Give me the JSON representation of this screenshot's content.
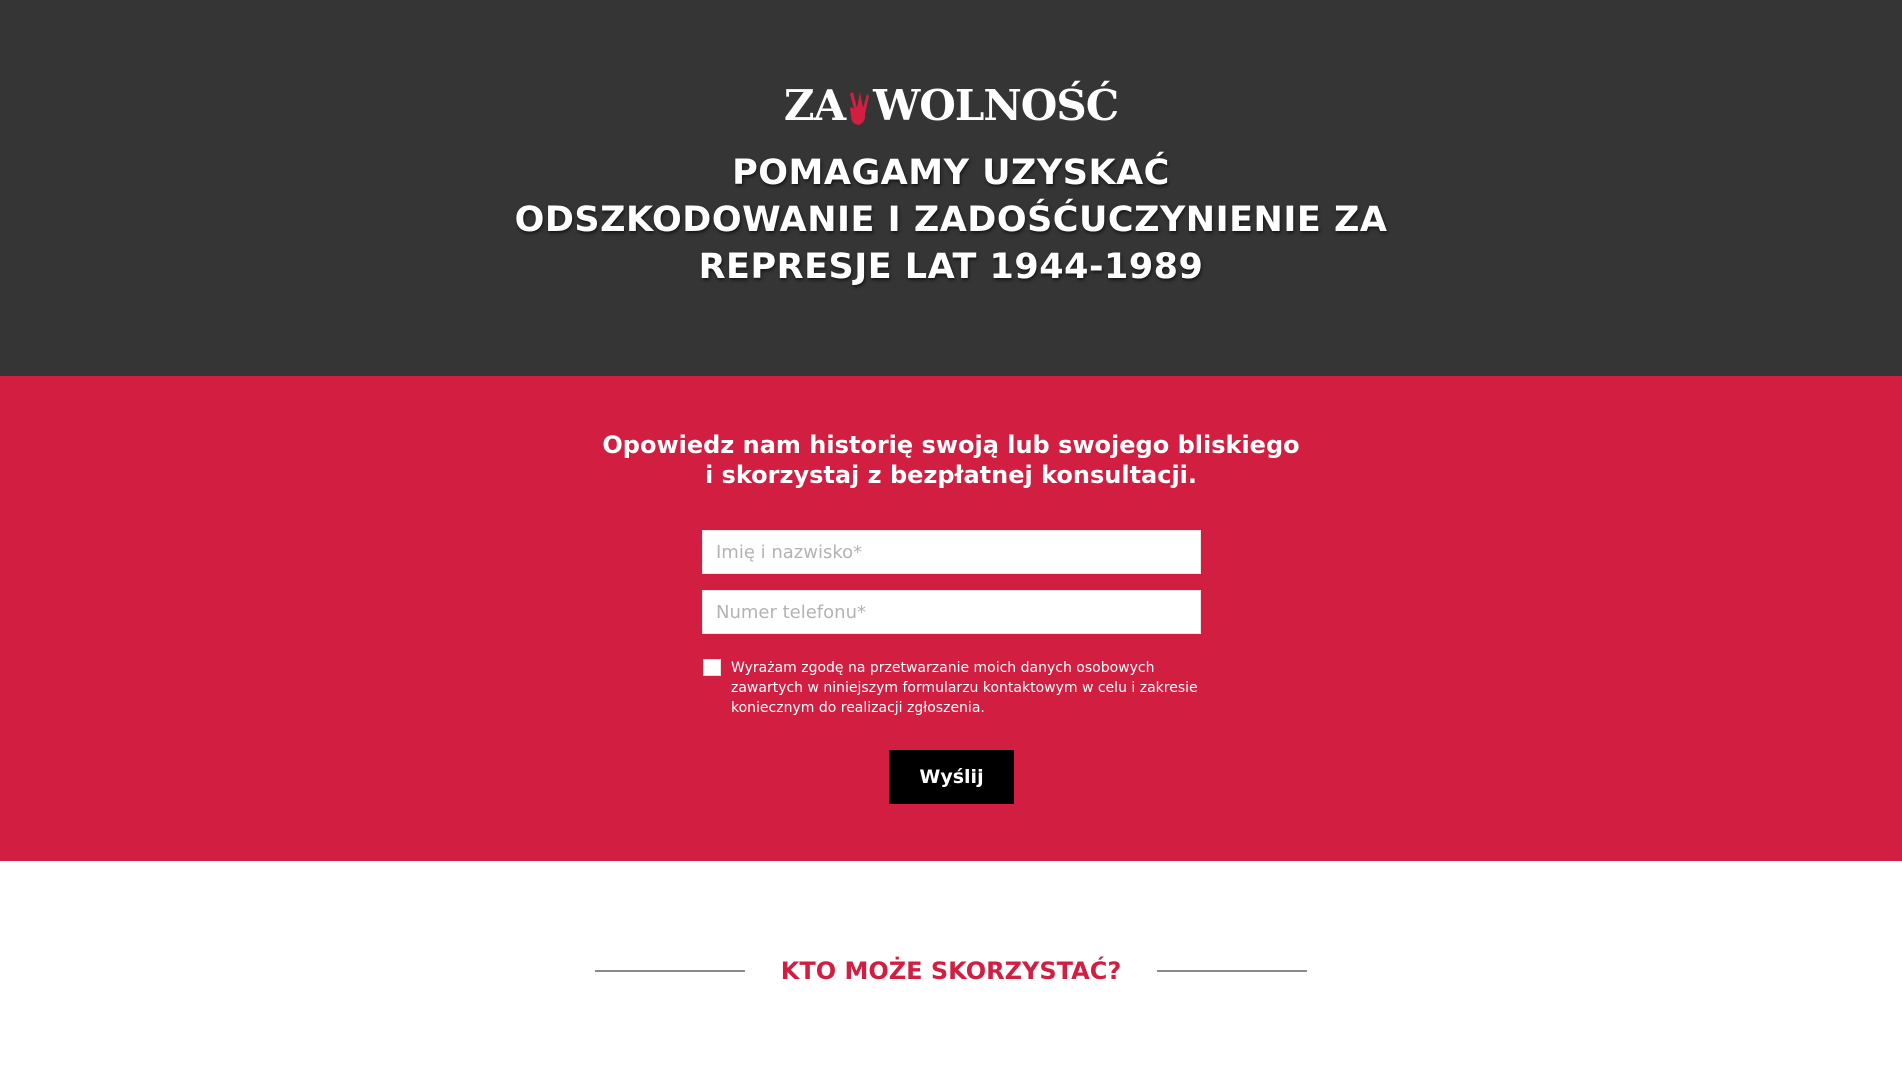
{
  "colors": {
    "hero_background": "#353535",
    "form_background": "#d21f41",
    "accent_red": "#d21f41",
    "button_background": "#000000",
    "top_strip_accent": "#2d6fb8"
  },
  "logo": {
    "part_left": "ZA",
    "part_right": "WOLNOŚĆ",
    "icon": "victory-hand-icon"
  },
  "hero": {
    "title_lines": [
      "POMAGAMY UZYSKAĆ",
      "ODSZKODOWANIE I ZADOŚĆUCZYNIENIE ZA",
      "REPRESJE LAT 1944-1989"
    ]
  },
  "form": {
    "heading_lines": [
      "Opowiedz nam historię swoją lub swojego bliskiego",
      "i skorzystaj z bezpłatnej konsultacji."
    ],
    "name_placeholder": "Imię i nazwisko*",
    "name_value": "",
    "phone_placeholder": "Numer telefonu*",
    "phone_value": "",
    "consent_checked": false,
    "consent_text": "Wyrażam zgodę na przetwarzanie moich danych osobowych zawartych w niniejszym formularzu kontaktowym w celu i zakresie koniecznym do realizacji zgłoszenia.",
    "submit_label": "Wyślij"
  },
  "who": {
    "title": "KTO MOŻE SKORZYSTAĆ?"
  }
}
